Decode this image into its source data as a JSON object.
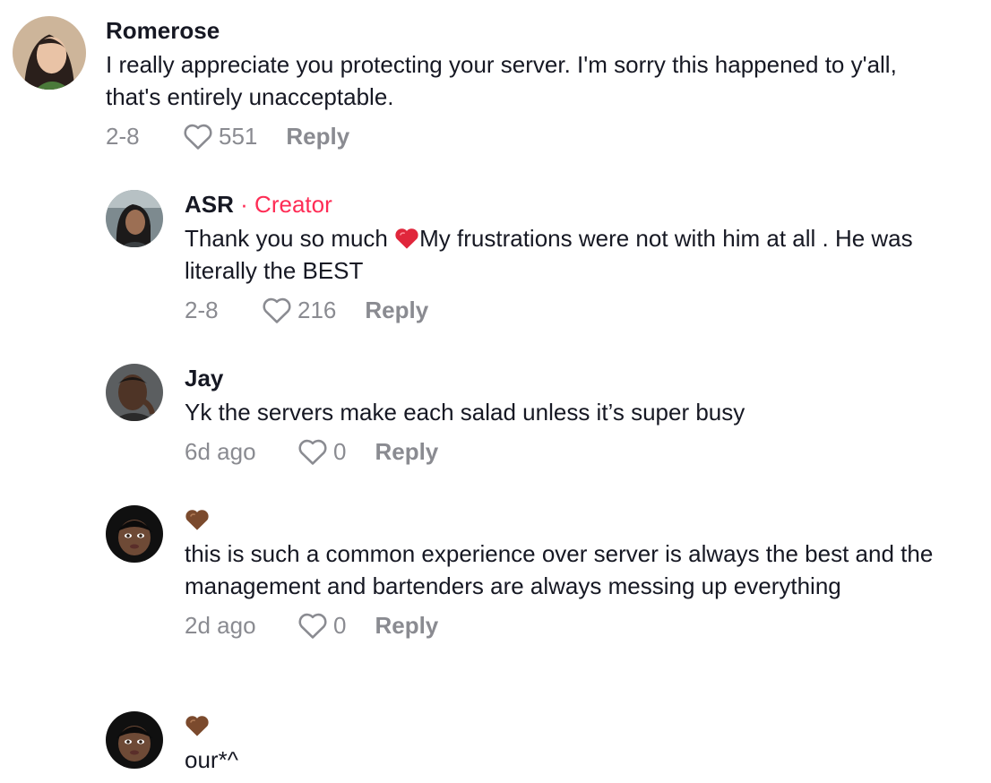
{
  "comments": [
    {
      "username": "Romerose",
      "text": "I really appreciate you protecting your server. I'm sorry this happened to y'all, that's entirely unacceptable.",
      "date": "2-8",
      "likes": "551",
      "reply_label": "Reply",
      "avatar_colors": {
        "bg": "#cdb59a",
        "hair": "#2a1f1b",
        "skin": "#e9c3a6",
        "shirt": "#4a7a3a"
      }
    },
    {
      "username": "ASR",
      "separator": "·",
      "badge": "Creator",
      "text_before_emoji": "Thank you so much ",
      "text_after_emoji": "My frustrations were not with him at all . He was literally the BEST",
      "emoji_icon": "red-heart-icon",
      "date": "2-8",
      "likes": "216",
      "reply_label": "Reply",
      "avatar_colors": {
        "bg": "#7d8a8f",
        "hair": "#1c1a1a",
        "skin": "#9c6f54",
        "shirt": "#3b3f42"
      }
    },
    {
      "username": "Jay",
      "text": "Yk the servers make each salad unless it’s super busy",
      "date": "6d ago",
      "likes": "0",
      "reply_label": "Reply",
      "avatar_colors": {
        "bg": "#5b5e60",
        "hair": "#1a1614",
        "skin": "#4e3426",
        "shirt": "#2a2a2a"
      }
    },
    {
      "username_icon": "brown-heart-icon",
      "text": "this is such a common experience over server is always the best and the management and bartenders are always messing up everything",
      "date": "2d ago",
      "likes": "0",
      "reply_label": "Reply",
      "avatar_colors": {
        "bg": "#101010",
        "hair": "#0c0b0b",
        "skin": "#6e4a36",
        "lips": "#5a2e2a"
      }
    },
    {
      "username_icon": "brown-heart-icon",
      "text": "our*^",
      "avatar_colors": {
        "bg": "#101010",
        "hair": "#0c0b0b",
        "skin": "#6e4a36",
        "lips": "#5a2e2a"
      }
    }
  ],
  "colors": {
    "creator": "#FE2C55",
    "meta": "#8a8b91",
    "brown_heart": "#7b4a2d",
    "red_heart": "#e0263b"
  }
}
